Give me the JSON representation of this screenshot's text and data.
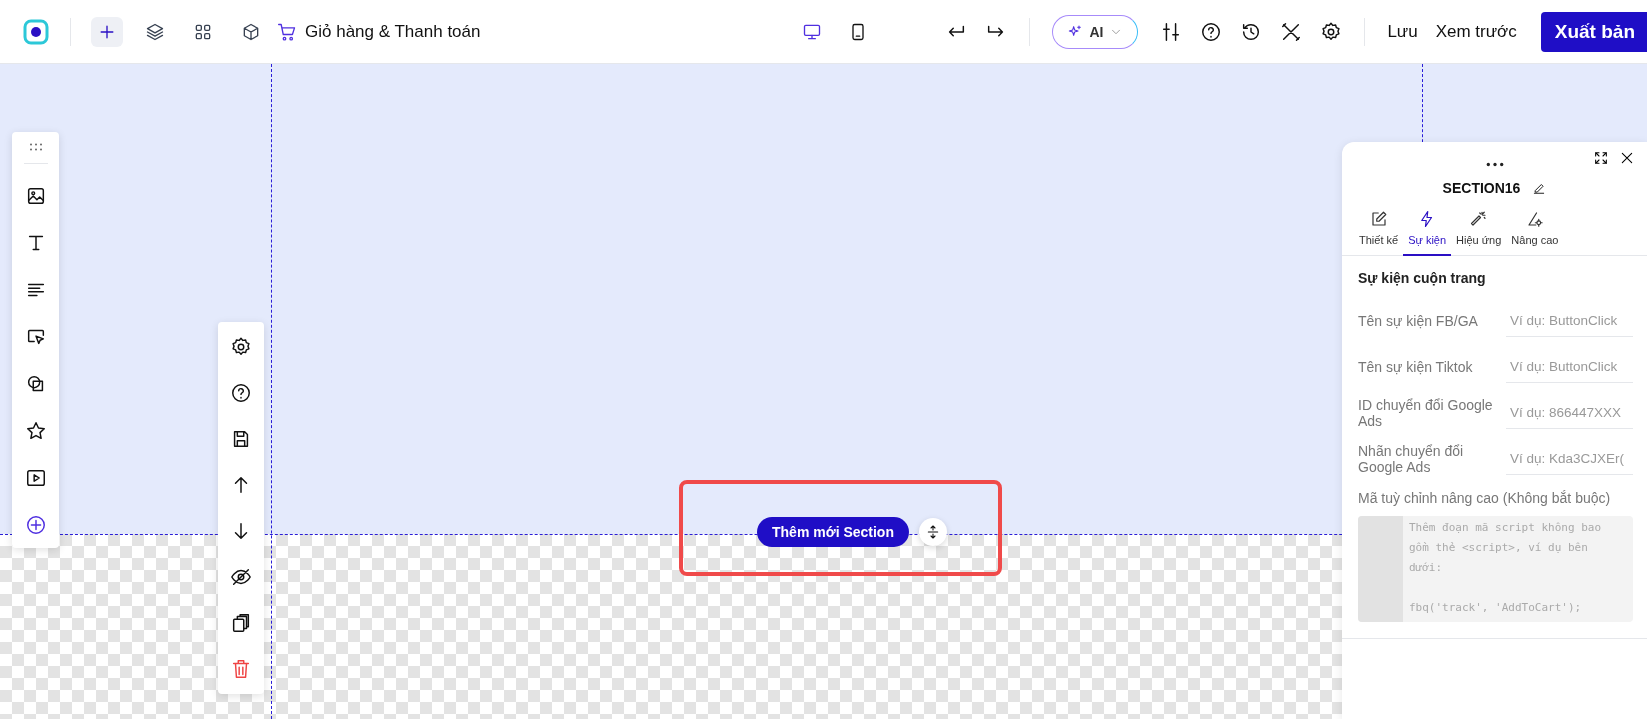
{
  "header": {
    "tools": [
      {
        "selected": true
      },
      {
        "selected": false
      },
      {
        "selected": false
      },
      {
        "selected": false
      }
    ],
    "cart_link": "Giỏ hàng & Thanh toán",
    "devices": [
      {
        "selected": true
      },
      {
        "selected": false
      }
    ],
    "ai_button": "AI",
    "save_link": "Lưu",
    "preview_link": "Xem trước",
    "publish_button": "Xuất bản"
  },
  "canvas": {
    "add_section_button": "Thêm mới Section"
  },
  "panel": {
    "title": "SECTION16",
    "tabs": [
      {
        "label": "Thiết kế",
        "selected": false
      },
      {
        "label": "Sự kiện",
        "selected": true
      },
      {
        "label": "Hiệu ứng",
        "selected": false
      },
      {
        "label": "Nâng cao",
        "selected": false
      }
    ],
    "heading": "Sự kiện cuộn trang",
    "fields": [
      {
        "label": "Tên sự kiện FB/GA",
        "placeholder": "Ví dụ: ButtonClick"
      },
      {
        "label": "Tên sự kiện Tiktok",
        "placeholder": "Ví dụ: ButtonClick"
      },
      {
        "label": "ID chuyển đổi Google Ads",
        "placeholder": "Ví dụ: 866447XXX"
      },
      {
        "label": "Nhãn chuyển đổi Google Ads",
        "placeholder": "Ví dụ: Kda3CJXEr("
      }
    ],
    "code_label": "Mã tuỳ chỉnh nâng cao (Không bắt buộc)",
    "code_placeholder": "Thêm đoạn mã script không bao gồm thẻ <script>, ví dụ bên dưới:\n\nfbq('track', 'AddToCart');"
  }
}
